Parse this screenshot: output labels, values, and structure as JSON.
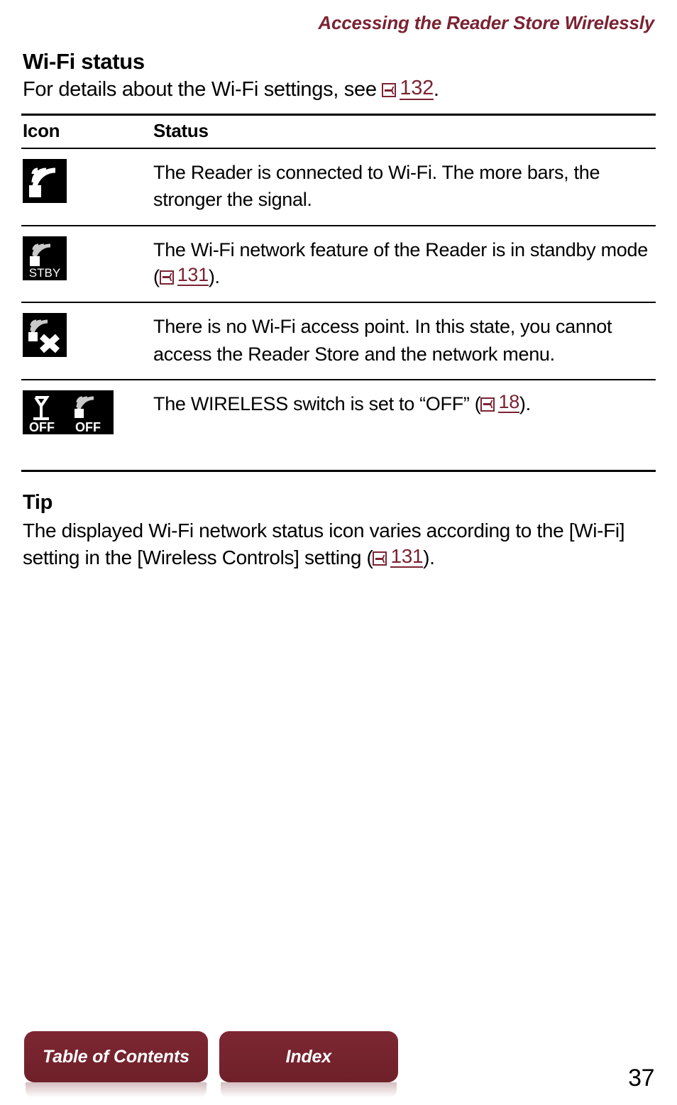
{
  "header": {
    "running_title": "Accessing the Reader Store Wirelessly",
    "accent_color": "#7B2332"
  },
  "section": {
    "title": "Wi-Fi status",
    "intro_before": "For details about the Wi-Fi settings, see",
    "intro_pageref": "132",
    "intro_after": "."
  },
  "table": {
    "columns": {
      "icon": "Icon",
      "status": "Status"
    },
    "rows": [
      {
        "icon_name": "wifi-connected-icon",
        "icon_label": "",
        "status_text": "The Reader is connected to Wi-Fi. The more bars, the stronger the signal.",
        "pageref": null
      },
      {
        "icon_name": "wifi-standby-icon",
        "icon_label": "STBY",
        "status_before": "The Wi-Fi network feature of the Reader is in standby mode (",
        "status_pageref": "131",
        "status_after": ")."
      },
      {
        "icon_name": "wifi-no-access-point-icon",
        "icon_label": "",
        "status_text": "There is no Wi-Fi access point. In this state, you cannot access the Reader Store and the network menu.",
        "pageref": null
      },
      {
        "icon_name": "wireless-off-icon",
        "icon_label_left": "OFF",
        "icon_label_right": "OFF",
        "status_before": "The WIRELESS switch is set to “OFF” (",
        "status_pageref": "18",
        "status_after": ")."
      }
    ]
  },
  "tip": {
    "title": "Tip",
    "body_before": "The displayed Wi-Fi network status icon varies according to the [Wi-Fi] setting in the [Wireless Controls] setting (",
    "pageref": "131",
    "body_after": ")."
  },
  "footer": {
    "buttons": [
      {
        "label": "Table of Contents",
        "name": "table-of-contents-button"
      },
      {
        "label": "Index",
        "name": "index-button"
      }
    ],
    "page_number": "37",
    "button_color": "#70222C"
  }
}
